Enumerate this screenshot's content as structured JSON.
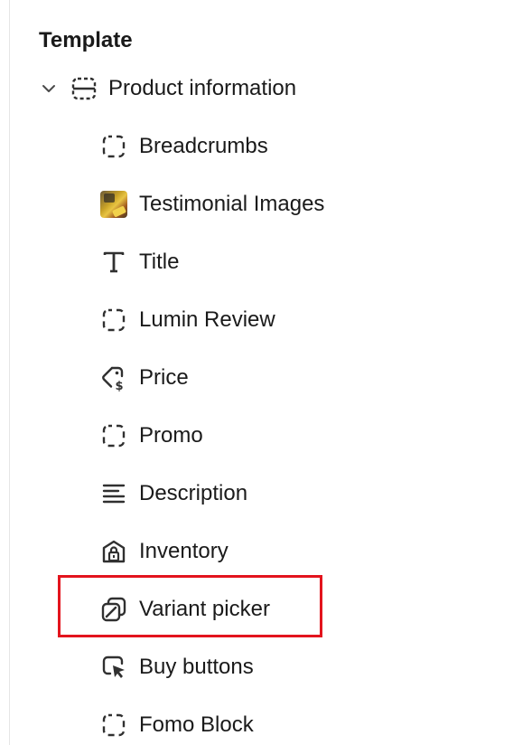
{
  "section": {
    "title": "Template"
  },
  "group": {
    "label": "Product information",
    "expanded": true,
    "icon": "section-dashed-icon"
  },
  "items": [
    {
      "label": "Breadcrumbs",
      "icon": "dashed-square-icon"
    },
    {
      "label": "Testimonial Images",
      "icon": "image-thumbnail"
    },
    {
      "label": "Title",
      "icon": "text-t-icon"
    },
    {
      "label": "Lumin Review",
      "icon": "dashed-square-icon"
    },
    {
      "label": "Price",
      "icon": "price-tag-icon"
    },
    {
      "label": "Promo",
      "icon": "dashed-square-icon"
    },
    {
      "label": "Description",
      "icon": "text-lines-icon"
    },
    {
      "label": "Inventory",
      "icon": "inventory-lock-icon"
    },
    {
      "label": "Variant picker",
      "icon": "variant-picker-icon",
      "highlighted": true
    },
    {
      "label": "Buy buttons",
      "icon": "cursor-click-icon"
    },
    {
      "label": "Fomo Block",
      "icon": "dashed-square-icon"
    }
  ],
  "colors": {
    "highlight_border": "#e3141d",
    "text": "#1a1a1a",
    "icon": "#303030"
  }
}
